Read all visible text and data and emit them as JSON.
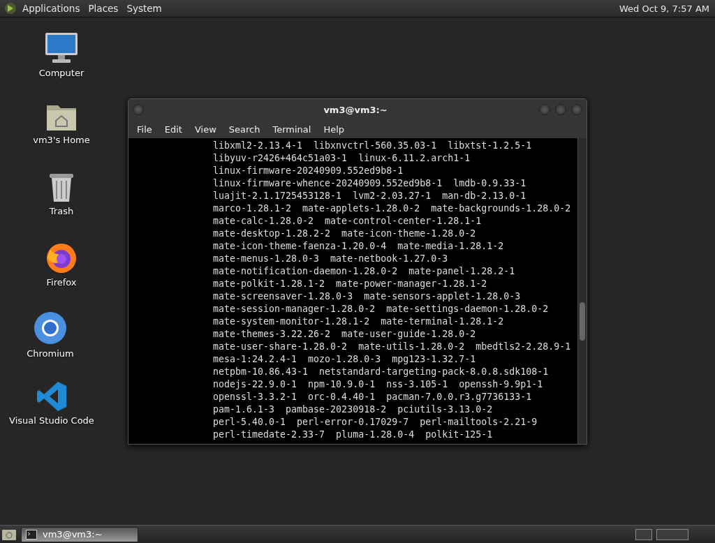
{
  "top_panel": {
    "menus": [
      "Applications",
      "Places",
      "System"
    ],
    "clock": "Wed Oct  9, 7:57 AM"
  },
  "desktop_icons": [
    {
      "kind": "computer",
      "label": "Computer"
    },
    {
      "kind": "home",
      "label": "vm3's Home"
    },
    {
      "kind": "trash",
      "label": "Trash"
    },
    {
      "kind": "firefox",
      "label": "Firefox"
    },
    {
      "kind": "chromium",
      "label": "Chromium"
    },
    {
      "kind": "vscode",
      "label": "Visual Studio Code"
    }
  ],
  "terminal": {
    "title": "vm3@vm3:~",
    "menus": [
      "File",
      "Edit",
      "View",
      "Search",
      "Terminal",
      "Help"
    ],
    "lines": [
      "libxml2-2.13.4-1  libxnvctrl-560.35.03-1  libxtst-1.2.5-1",
      "libyuv-r2426+464c51a03-1  linux-6.11.2.arch1-1",
      "linux-firmware-20240909.552ed9b8-1",
      "linux-firmware-whence-20240909.552ed9b8-1  lmdb-0.9.33-1",
      "luajit-2.1.1725453128-1  lvm2-2.03.27-1  man-db-2.13.0-1",
      "marco-1.28.1-2  mate-applets-1.28.0-2  mate-backgrounds-1.28.0-2",
      "mate-calc-1.28.0-2  mate-control-center-1.28.1-1",
      "mate-desktop-1.28.2-2  mate-icon-theme-1.28.0-2",
      "mate-icon-theme-faenza-1.20.0-4  mate-media-1.28.1-2",
      "mate-menus-1.28.0-3  mate-netbook-1.27.0-3",
      "mate-notification-daemon-1.28.0-2  mate-panel-1.28.2-1",
      "mate-polkit-1.28.1-2  mate-power-manager-1.28.1-2",
      "mate-screensaver-1.28.0-3  mate-sensors-applet-1.28.0-3",
      "mate-session-manager-1.28.0-2  mate-settings-daemon-1.28.0-2",
      "mate-system-monitor-1.28.1-2  mate-terminal-1.28.1-2",
      "mate-themes-3.22.26-2  mate-user-guide-1.28.0-2",
      "mate-user-share-1.28.0-2  mate-utils-1.28.0-2  mbedtls2-2.28.9-1",
      "mesa-1:24.2.4-1  mozo-1.28.0-3  mpg123-1.32.7-1",
      "netpbm-10.86.43-1  netstandard-targeting-pack-8.0.8.sdk108-1",
      "nodejs-22.9.0-1  npm-10.9.0-1  nss-3.105-1  openssh-9.9p1-1",
      "openssl-3.3.2-1  orc-0.4.40-1  pacman-7.0.0.r3.g7736133-1",
      "pam-1.6.1-3  pambase-20230918-2  pciutils-3.13.0-2",
      "perl-5.40.0-1  perl-error-0.17029-7  perl-mailtools-2.21-9",
      "perl-timedate-2.33-7  pluma-1.28.0-4  polkit-125-1"
    ]
  },
  "taskbar": {
    "tasks": [
      {
        "label": "vm3@vm3:~",
        "selected": true
      }
    ]
  }
}
